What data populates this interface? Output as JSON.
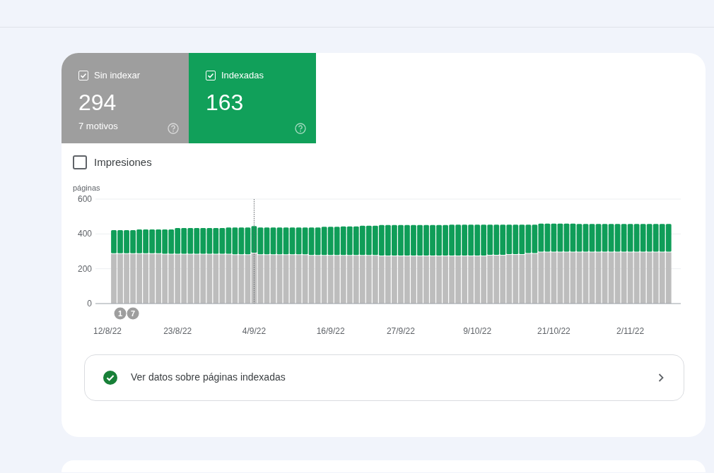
{
  "summary_tiles": [
    {
      "label": "Sin indexar",
      "checked": true,
      "value": "294",
      "subtitle": "7 motivos",
      "kind": "not_indexed"
    },
    {
      "label": "Indexadas",
      "checked": true,
      "value": "163",
      "kind": "indexed"
    }
  ],
  "impressions_toggle": {
    "label": "Impresiones",
    "checked": false
  },
  "chart_data": {
    "type": "bar",
    "stacked": true,
    "ylabel": "páginas",
    "ylim": [
      0,
      600
    ],
    "yticks": [
      0,
      200,
      400,
      600
    ],
    "categories": [
      "12/8/22",
      null,
      null,
      null,
      null,
      null,
      null,
      null,
      null,
      null,
      null,
      "23/8/22",
      null,
      null,
      null,
      null,
      null,
      null,
      null,
      null,
      null,
      null,
      null,
      "4/9/22",
      null,
      null,
      null,
      null,
      null,
      null,
      null,
      null,
      null,
      null,
      null,
      "16/9/22",
      null,
      null,
      null,
      null,
      null,
      null,
      null,
      null,
      null,
      null,
      "27/9/22",
      null,
      null,
      null,
      null,
      null,
      null,
      null,
      null,
      null,
      null,
      null,
      "9/10/22",
      null,
      null,
      null,
      null,
      null,
      null,
      null,
      null,
      null,
      null,
      null,
      "21/10/22",
      null,
      null,
      null,
      null,
      null,
      null,
      null,
      null,
      null,
      null,
      null,
      "2/11/22",
      null,
      null,
      null,
      null,
      null,
      null
    ],
    "series": [
      {
        "color": "#bdbdbd",
        "values": [
          null,
          285,
          285,
          285,
          285,
          285,
          285,
          285,
          285,
          282,
          282,
          282,
          282,
          282,
          282,
          282,
          282,
          282,
          282,
          282,
          279,
          279,
          279,
          288,
          279,
          279,
          279,
          279,
          279,
          279,
          279,
          279,
          275,
          275,
          275,
          275,
          275,
          275,
          275,
          275,
          275,
          275,
          275,
          272,
          272,
          272,
          272,
          272,
          272,
          272,
          272,
          272,
          272,
          272,
          272,
          272,
          272,
          272,
          272,
          272,
          276,
          276,
          276,
          280,
          280,
          280,
          286,
          286,
          294,
          294,
          294,
          294,
          294,
          294,
          294,
          294,
          294,
          294,
          294,
          294,
          294,
          294,
          294,
          294,
          294,
          294,
          294,
          294,
          294
        ]
      },
      {
        "color": "#0f9d58",
        "values": [
          null,
          137,
          137,
          137,
          137,
          141,
          141,
          141,
          141,
          144,
          144,
          152,
          152,
          152,
          152,
          152,
          152,
          152,
          152,
          155,
          158,
          158,
          158,
          157,
          158,
          158,
          158,
          158,
          158,
          158,
          158,
          158,
          162,
          162,
          166,
          166,
          166,
          168,
          168,
          168,
          172,
          172,
          172,
          179,
          179,
          179,
          179,
          179,
          179,
          179,
          179,
          179,
          179,
          179,
          181,
          181,
          181,
          181,
          181,
          181,
          177,
          177,
          177,
          173,
          173,
          173,
          167,
          167,
          165,
          165,
          165,
          165,
          165,
          165,
          163,
          163,
          163,
          163,
          163,
          163,
          163,
          163,
          163,
          163,
          163,
          163,
          163,
          163,
          163
        ]
      }
    ],
    "annotations": [
      "1",
      "7"
    ]
  },
  "details_link": {
    "label": "Ver datos sobre páginas indexadas"
  }
}
